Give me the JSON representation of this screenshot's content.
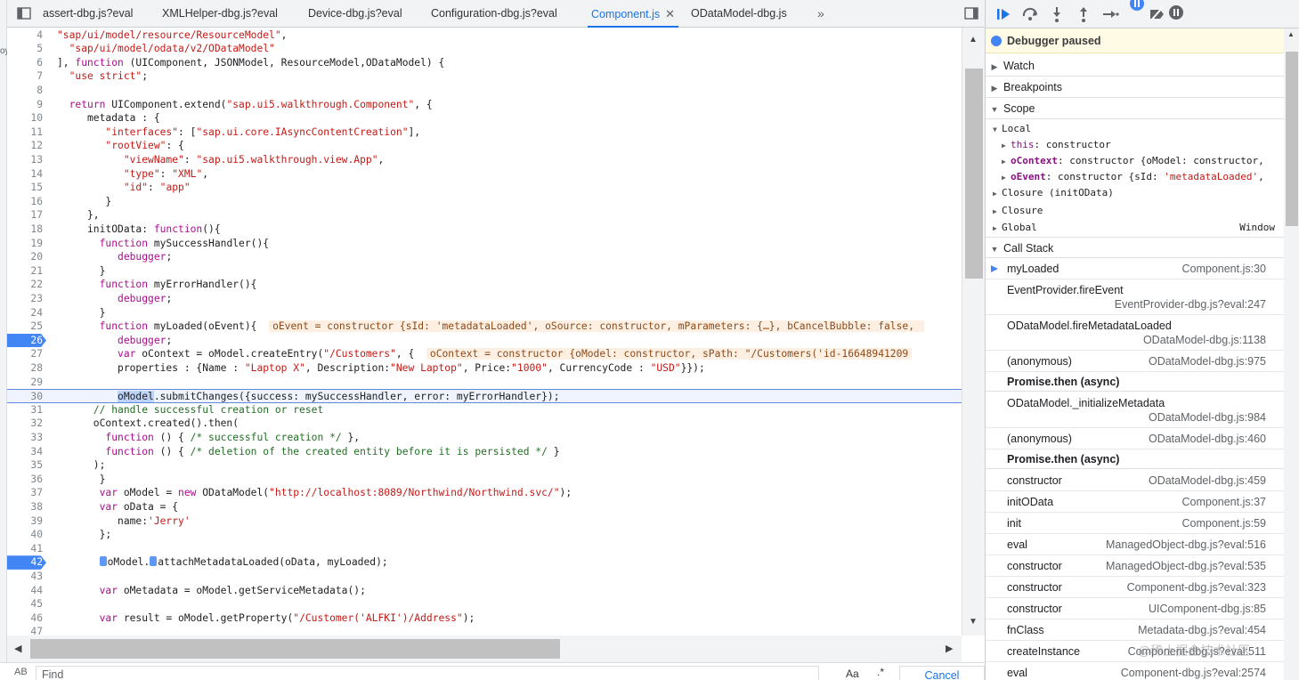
{
  "tabs": [
    {
      "label": "assert-dbg.js?eval"
    },
    {
      "label": "XMLHelper-dbg.js?eval"
    },
    {
      "label": "Device-dbg.js?eval"
    },
    {
      "label": "Configuration-dbg.js?eval"
    },
    {
      "label": "Component.js",
      "active": true
    },
    {
      "label": "ODataModel-dbg.js"
    }
  ],
  "editor": {
    "lines": [
      {
        "n": "4",
        "html": "<span class=\"str\">\"sap/ui/model/resource/ResourceModel\"</span>,"
      },
      {
        "n": "5",
        "html": "  <span class=\"str\">\"sap/ui/model/odata/v2/ODataModel\"</span>"
      },
      {
        "n": "6",
        "html": "], <span class=\"kw\">function</span> (UIComponent, JSONModel, ResourceModel,ODataModel) {"
      },
      {
        "n": "7",
        "html": "  <span class=\"str\">\"use strict\"</span>;"
      },
      {
        "n": "8",
        "html": ""
      },
      {
        "n": "9",
        "html": "  <span class=\"kw\">return</span> UIComponent.extend(<span class=\"str\">\"sap.ui5.walkthrough.Component\"</span>, {"
      },
      {
        "n": "10",
        "html": "     metadata : {"
      },
      {
        "n": "11",
        "html": "        <span class=\"str\">\"interfaces\"</span>: [<span class=\"str\">\"sap.ui.core.IAsyncContentCreation\"</span>],"
      },
      {
        "n": "12",
        "html": "        <span class=\"str\">\"rootView\"</span>: {"
      },
      {
        "n": "13",
        "html": "           <span class=\"str\">\"viewName\"</span>: <span class=\"str\">\"sap.ui5.walkthrough.view.App\"</span>,"
      },
      {
        "n": "14",
        "html": "           <span class=\"str\">\"type\"</span>: <span class=\"str\">\"XML\"</span>,"
      },
      {
        "n": "15",
        "html": "           <span class=\"str\">\"id\"</span>: <span class=\"str\">\"app\"</span>"
      },
      {
        "n": "16",
        "html": "        }"
      },
      {
        "n": "17",
        "html": "     },"
      },
      {
        "n": "18",
        "html": "     initOData: <span class=\"kw\">function</span>(){"
      },
      {
        "n": "19",
        "html": "       <span class=\"kw\">function</span> mySuccessHandler(){"
      },
      {
        "n": "20",
        "html": "          <span class=\"kw\">debugger</span>;"
      },
      {
        "n": "21",
        "html": "       }"
      },
      {
        "n": "22",
        "html": "       <span class=\"kw\">function</span> myErrorHandler(){"
      },
      {
        "n": "23",
        "html": "          <span class=\"kw\">debugger</span>;"
      },
      {
        "n": "24",
        "html": "       }"
      },
      {
        "n": "25",
        "html": "       <span class=\"kw\">function</span> myLoaded(oEvent){  <span class=\"inline-val\">oEvent = constructor {sId: 'metadataLoaded', oSource: constructor, mParameters: {…}, bCancelBubble: false, </span>"
      },
      {
        "n": "26",
        "html": "          <span class=\"kw\">debugger</span>;",
        "bp": true
      },
      {
        "n": "27",
        "html": "          <span class=\"kw\">var</span> oContext = oModel.createEntry(<span class=\"str\">\"/Customers\"</span>, {  <span class=\"inline-val\">oContext = constructor {oModel: constructor, sPath: \"/Customers('id-16648941209</span>"
      },
      {
        "n": "28",
        "html": "          properties : {Name : <span class=\"str\">\"Laptop X\"</span>, Description:<span class=\"str\">\"New Laptop\"</span>, Price:<span class=\"str\">\"1000\"</span>, CurrencyCode : <span class=\"str\">\"USD\"</span>}});"
      },
      {
        "n": "29",
        "html": ""
      },
      {
        "n": "30",
        "html": "          <span class=\"sel\">oModel</span>.submitChanges({success: mySuccessHandler, error: myErrorHandler});",
        "current": true
      },
      {
        "n": "31",
        "html": "      <span class=\"cm\">// handle successful creation or reset</span>"
      },
      {
        "n": "32",
        "html": "      oContext.created().then("
      },
      {
        "n": "33",
        "html": "        <span class=\"kw\">function</span> () { <span class=\"cm\">/* successful creation */</span> },"
      },
      {
        "n": "34",
        "html": "        <span class=\"kw\">function</span> () { <span class=\"cm\">/* deletion of the created entity before it is persisted */</span> }"
      },
      {
        "n": "35",
        "html": "      );"
      },
      {
        "n": "36",
        "html": "       }"
      },
      {
        "n": "37",
        "html": "       <span class=\"kw\">var</span> oModel = <span class=\"kw\">new</span> ODataModel(<span class=\"str\">\"http://localhost:8089/Northwind/Northwind.svc/\"</span>);"
      },
      {
        "n": "38",
        "html": "       <span class=\"kw\">var</span> oData = {"
      },
      {
        "n": "39",
        "html": "          name:<span class=\"str\">'Jerry'</span>"
      },
      {
        "n": "40",
        "html": "       };"
      },
      {
        "n": "41",
        "html": ""
      },
      {
        "n": "42",
        "html": "       <span class=\"bpmarker\"></span>oModel.<span class=\"bpmarker\"></span>attachMetadataLoaded(oData, myLoaded);",
        "bp": true
      },
      {
        "n": "43",
        "html": ""
      },
      {
        "n": "44",
        "html": "       <span class=\"kw\">var</span> oMetadata = oModel.getServiceMetadata();"
      },
      {
        "n": "45",
        "html": ""
      },
      {
        "n": "46",
        "html": "       <span class=\"kw\">var</span> result = oModel.getProperty(<span class=\"str\">\"/Customer('ALFKI')/Address\"</span>);"
      },
      {
        "n": "47",
        "html": ""
      }
    ]
  },
  "find": {
    "placeholder": "Find",
    "case_label": "Aa",
    "regex_label": ".*",
    "cancel_label": "Cancel",
    "ab_label": "AB"
  },
  "debugger": {
    "paused_label": "Debugger paused",
    "watch_label": "Watch",
    "breakpoints_label": "Breakpoints",
    "scope_label": "Scope",
    "local_label": "Local",
    "scope_rows": [
      {
        "key": "this",
        "value": ": constructor",
        "indent": 1
      },
      {
        "key": "oContext",
        "value": ": constructor {oModel: constructor,",
        "indent": 1,
        "bold": true
      },
      {
        "key": "oEvent",
        "value": ": constructor {sId: ",
        "str": "'metadataLoaded'",
        "tail": ",",
        "indent": 1,
        "bold": true
      }
    ],
    "closure_init_label": "Closure (initOData)",
    "closure_label": "Closure",
    "global_label": "Global",
    "global_value": "Window",
    "callstack_label": "Call Stack",
    "frames": [
      {
        "fn": "myLoaded",
        "loc": "Component.js:30",
        "current": true
      },
      {
        "fn": "EventProvider.fireEvent",
        "loc": "EventProvider-dbg.js?eval:247",
        "two": true
      },
      {
        "fn": "ODataModel.fireMetadataLoaded",
        "loc": "ODataModel-dbg.js:1138",
        "two": true
      },
      {
        "fn": "(anonymous)",
        "loc": "ODataModel-dbg.js:975"
      },
      {
        "async": "Promise.then (async)"
      },
      {
        "fn": "ODataModel._initializeMetadata",
        "loc": "ODataModel-dbg.js:984",
        "two": true
      },
      {
        "fn": "(anonymous)",
        "loc": "ODataModel-dbg.js:460"
      },
      {
        "async": "Promise.then (async)"
      },
      {
        "fn": "constructor",
        "loc": "ODataModel-dbg.js:459"
      },
      {
        "fn": "initOData",
        "loc": "Component.js:37"
      },
      {
        "fn": "init",
        "loc": "Component.js:59"
      },
      {
        "fn": "eval",
        "loc": "ManagedObject-dbg.js?eval:516"
      },
      {
        "fn": "constructor",
        "loc": "ManagedObject-dbg.js?eval:535"
      },
      {
        "fn": "constructor",
        "loc": "Component-dbg.js?eval:323"
      },
      {
        "fn": "constructor",
        "loc": "UIComponent-dbg.js:85"
      },
      {
        "fn": "fnClass",
        "loc": "Metadata-dbg.js?eval:454"
      },
      {
        "fn": "createInstance",
        "loc": "Component-dbg.js?eval:511"
      },
      {
        "fn": "eval",
        "loc": "Component-dbg.js?eval:2574"
      }
    ]
  },
  "watermark": "@稀土掘金技术社区",
  "left_fragment": "oy"
}
